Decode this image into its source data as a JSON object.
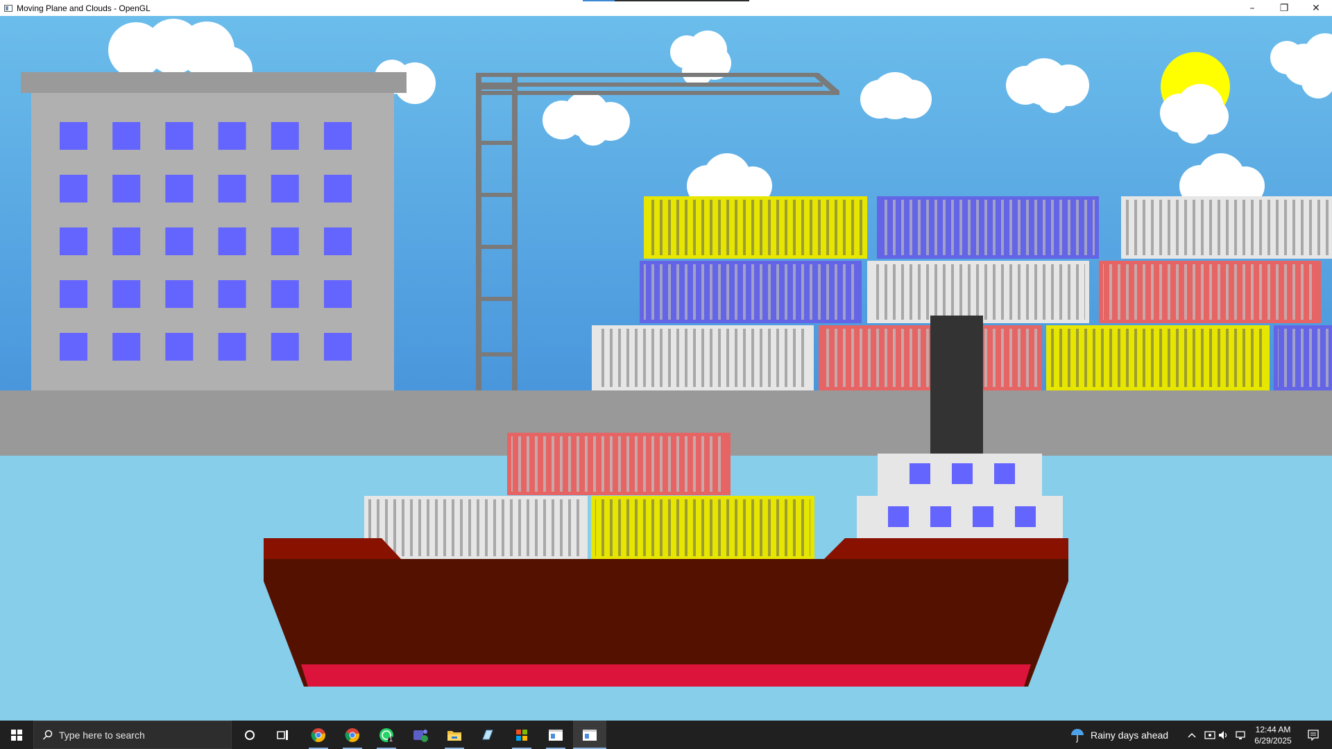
{
  "window": {
    "title": "Moving Plane and Clouds - OpenGL",
    "controls": {
      "minimize": "–",
      "restore": "❐",
      "close": "✕"
    }
  },
  "colors": {
    "sky_top": "#6bbdeb",
    "sky_bottom": "#4a96dc",
    "water": "#87ceeb",
    "dock": "#999999",
    "building": "#b0b0b0",
    "building_roof": "#9a9a9a",
    "window_blue": "#6464ff",
    "crane": "#7a7a7a",
    "sun": "#ffff00",
    "cloud": "#ffffff",
    "container_yellow": "#e6e600",
    "container_blue": "#6464e6",
    "container_white": "#e6e6e6",
    "container_red": "#e66464",
    "hull_dark": "#551100",
    "hull_deck": "#881100",
    "hull_stripe": "#dc143c",
    "cabin": "#e6e6e6",
    "smokestack": "#333333",
    "taskbar": "#202020"
  },
  "scene": {
    "building_windows": {
      "rows": 5,
      "cols": 6
    },
    "stacked_containers": [
      "yellow",
      "blue",
      "white",
      "blue",
      "white",
      "red",
      "white",
      "red",
      "yellow",
      "blue"
    ],
    "ship_containers": [
      "red",
      "white",
      "yellow"
    ],
    "cabin_windows": {
      "upper": 3,
      "lower": 4
    }
  },
  "taskbar": {
    "search_placeholder": "Type here to search",
    "weather": "Rainy days ahead",
    "time": "12:44 AM",
    "date": "6/29/2025",
    "apps": [
      "cortana-icon",
      "task-view-icon",
      "chrome-icon",
      "chrome-profile-icon",
      "whatsapp-icon",
      "teams-icon",
      "file-explorer-icon",
      "notepad-icon",
      "store-icon",
      "opengl-app-icon",
      "opengl-window-icon"
    ],
    "whatsapp_badge": "1"
  }
}
